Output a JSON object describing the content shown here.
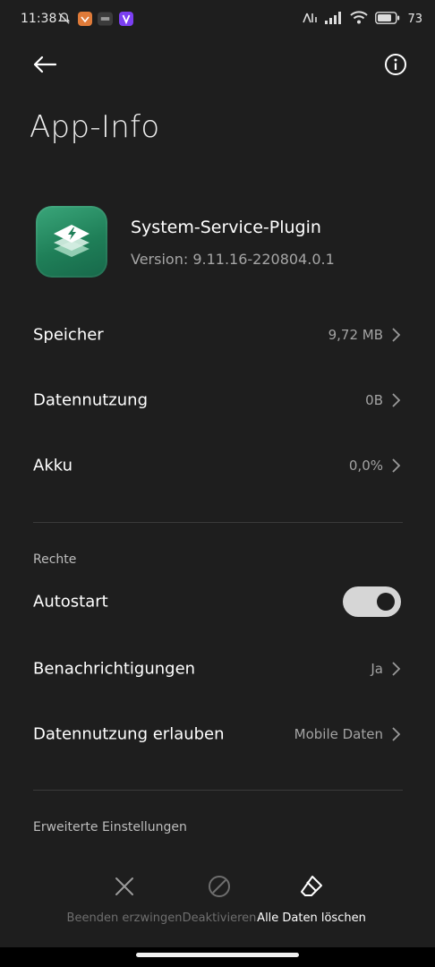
{
  "status_bar": {
    "time": "11:38",
    "battery": "73"
  },
  "page_title": "App-Info",
  "app": {
    "name": "System-Service-Plugin",
    "version": "Version: 9.11.16-220804.0.1"
  },
  "storage_rows": [
    {
      "label": "Speicher",
      "value": "9,72 MB"
    },
    {
      "label": "Datennutzung",
      "value": "0B"
    },
    {
      "label": "Akku",
      "value": "0,0%"
    }
  ],
  "rights": {
    "section_label": "Rechte",
    "autostart_label": "Autostart",
    "autostart_on": true,
    "rows": [
      {
        "label": "Benachrichtigungen",
        "value": "Ja"
      },
      {
        "label": "Datennutzung erlauben",
        "value": "Mobile Daten"
      }
    ]
  },
  "advanced": {
    "section_label": "Erweiterte Einstellungen"
  },
  "actions": {
    "force_stop": "Beenden erzwingen",
    "disable": "Deaktivieren",
    "clear_data": "Alle Daten löschen"
  },
  "colors": {
    "background": "#1e1e1e",
    "app_icon_green": "#1f7f58",
    "toggle_on": "#d6d6d6",
    "disabled_text": "#6e6e6e"
  }
}
